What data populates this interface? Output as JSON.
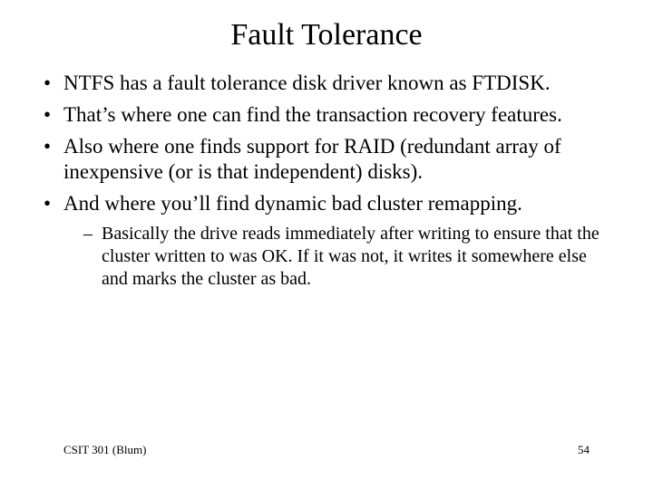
{
  "title": "Fault Tolerance",
  "bullets": [
    {
      "text": "NTFS has a fault tolerance disk driver known as FTDISK."
    },
    {
      "text": "That’s where one can find the transaction recovery features."
    },
    {
      "text": "Also where one finds support for RAID (redundant array of inexpensive (or is that independent) disks)."
    },
    {
      "text": "And where you’ll find dynamic bad cluster remapping.",
      "sub": [
        "Basically the drive reads immediately after writing to ensure that the cluster written to was OK.  If it was not, it writes it somewhere else and marks the cluster as bad."
      ]
    }
  ],
  "footer": {
    "left": "CSIT 301 (Blum)",
    "right": "54"
  }
}
